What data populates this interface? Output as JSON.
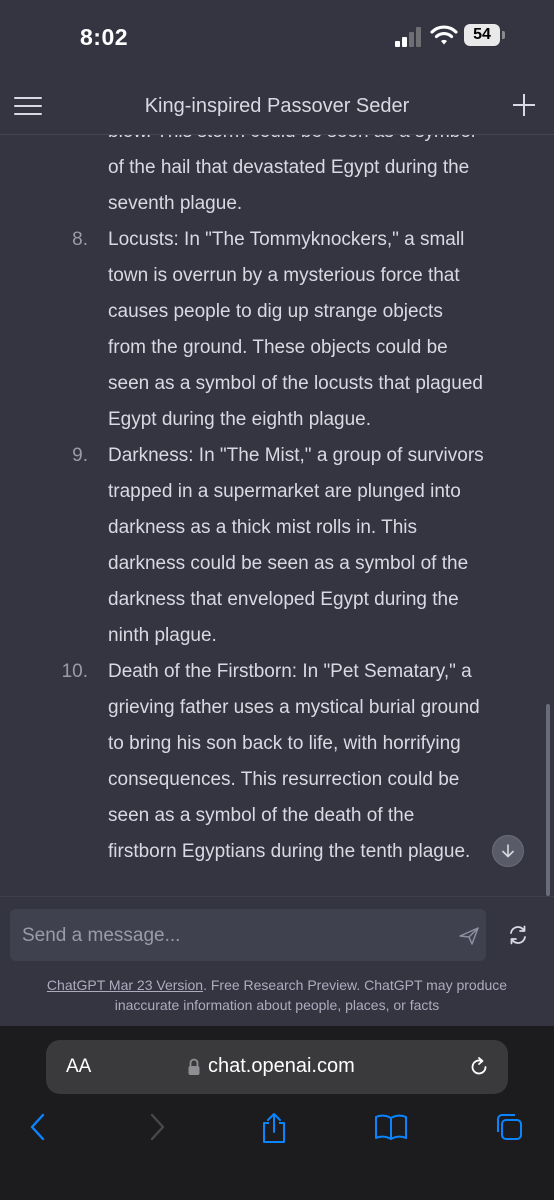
{
  "status_bar": {
    "time": "8:02",
    "battery": "54"
  },
  "header": {
    "title": "King-inspired Passover Seder",
    "menu_icon": "hamburger-menu-icon",
    "new_chat_icon": "plus-icon"
  },
  "message": {
    "partial_item": {
      "lines": [
        "blow. This storm could be seen as a symbol",
        "of the hail that devastated Egypt during the",
        "seventh plague."
      ]
    },
    "items": [
      {
        "number": "8.",
        "lines": [
          "Locusts: In \"The Tommyknockers,\" a small",
          "town is overrun by a mysterious force that",
          "causes people to dig up strange objects",
          "from the ground. These objects could be",
          "seen as a symbol of the locusts that plagued",
          "Egypt during the eighth plague."
        ]
      },
      {
        "number": "9.",
        "lines": [
          "Darkness: In \"The Mist,\" a group of survivors",
          "trapped in a supermarket are plunged into",
          "darkness as a thick mist rolls in. This",
          "darkness could be seen as a symbol of the",
          "darkness that enveloped Egypt during the",
          "ninth plague."
        ]
      },
      {
        "number": "10.",
        "lines": [
          "Death of the Firstborn: In \"Pet Sematary,\" a",
          "grieving father uses a mystical burial ground",
          "to bring his son back to life, with horrifying",
          "consequences. This resurrection could be",
          "seen as a symbol of the death of the",
          "firstborn Egyptians during the tenth plague."
        ]
      }
    ]
  },
  "composer": {
    "placeholder": "Send a message...",
    "send_icon": "send-icon",
    "regenerate_icon": "regenerate-icon"
  },
  "disclaimer": {
    "link": "ChatGPT Mar 23 Version",
    "rest": ". Free Research Preview. ChatGPT may produce inaccurate information about people, places, or facts"
  },
  "browser": {
    "aa_label": "AA",
    "url": "chat.openai.com"
  },
  "colors": {
    "background": "#343541",
    "input": "#40414f",
    "safari_bar": "#1c1c1e",
    "accent_blue": "#0a84ff"
  }
}
